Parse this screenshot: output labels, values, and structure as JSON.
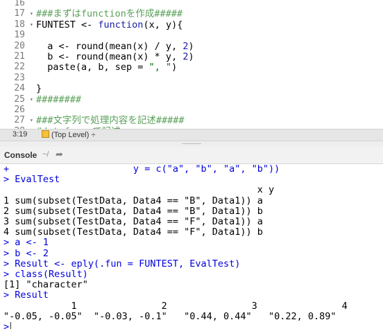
{
  "editor": {
    "lines": [
      {
        "num": "16",
        "fold": "",
        "segs": []
      },
      {
        "num": "17",
        "fold": "▾",
        "segs": [
          {
            "t": "###まずはfunctionを作成#####",
            "c": "cmt"
          }
        ]
      },
      {
        "num": "18",
        "fold": "▾",
        "segs": [
          {
            "t": "FUNTEST <- ",
            "c": ""
          },
          {
            "t": "function",
            "c": "kw"
          },
          {
            "t": "(x, y){",
            "c": ""
          }
        ]
      },
      {
        "num": "19",
        "fold": "",
        "segs": []
      },
      {
        "num": "20",
        "fold": "",
        "segs": [
          {
            "t": "  a <- round(mean(x) / y, ",
            "c": ""
          },
          {
            "t": "2",
            "c": "num"
          },
          {
            "t": ")",
            "c": ""
          }
        ]
      },
      {
        "num": "21",
        "fold": "",
        "segs": [
          {
            "t": "  b <- round(mean(x) * y, ",
            "c": ""
          },
          {
            "t": "2",
            "c": "num"
          },
          {
            "t": ")",
            "c": ""
          }
        ]
      },
      {
        "num": "22",
        "fold": "",
        "segs": [
          {
            "t": "  paste(a, b, sep = ",
            "c": ""
          },
          {
            "t": "\", \"",
            "c": "str"
          },
          {
            "t": ")",
            "c": ""
          }
        ]
      },
      {
        "num": "23",
        "fold": "",
        "segs": []
      },
      {
        "num": "24",
        "fold": "",
        "segs": [
          {
            "t": "}",
            "c": ""
          }
        ]
      },
      {
        "num": "25",
        "fold": "▾",
        "segs": [
          {
            "t": "########",
            "c": "cmt"
          }
        ]
      },
      {
        "num": "26",
        "fold": "",
        "segs": []
      },
      {
        "num": "27",
        "fold": "▾",
        "segs": [
          {
            "t": "###文字列で処理内容を記述#####",
            "c": "cmt"
          }
        ]
      },
      {
        "num": "28",
        "fold": "",
        "segs": [
          {
            "t": "#dataframeで記述",
            "c": "cmt"
          }
        ]
      }
    ]
  },
  "statusbar": {
    "position": "3:19",
    "level": "(Top Level)",
    "level_caret": "÷"
  },
  "console_header": {
    "title": "Console",
    "dir": "~/",
    "arrow_icon": "➦"
  },
  "console": {
    "lines": [
      {
        "t": "+                      y = c(\"a\", \"b\", \"a\", \"b\"))",
        "c": "blue"
      },
      {
        "t": "> EvalTest",
        "c": "blue"
      },
      {
        "t": "                                             x y",
        "c": ""
      },
      {
        "t": "1 sum(subset(TestData, Data4 == \"B\", Data1)) a",
        "c": ""
      },
      {
        "t": "2 sum(subset(TestData, Data4 == \"B\", Data1)) b",
        "c": ""
      },
      {
        "t": "3 sum(subset(TestData, Data4 == \"F\", Data1)) a",
        "c": ""
      },
      {
        "t": "4 sum(subset(TestData, Data4 == \"F\", Data1)) b",
        "c": ""
      },
      {
        "t": "> a <- 1",
        "c": "blue"
      },
      {
        "t": "> b <- 2",
        "c": "blue"
      },
      {
        "t": "> Result <- eply(.fun = FUNTEST, EvalTest)",
        "c": "blue"
      },
      {
        "t": "> class(Result)",
        "c": "blue"
      },
      {
        "t": "[1] \"character\"",
        "c": ""
      },
      {
        "t": "> Result",
        "c": "blue"
      },
      {
        "t": "            1               2               3               4",
        "c": ""
      },
      {
        "t": "\"-0.05, -0.05\"  \"-0.03, -0.1\"   \"0.44, 0.44\"   \"0.22, 0.89\"",
        "c": ""
      }
    ],
    "prompt": ">"
  }
}
